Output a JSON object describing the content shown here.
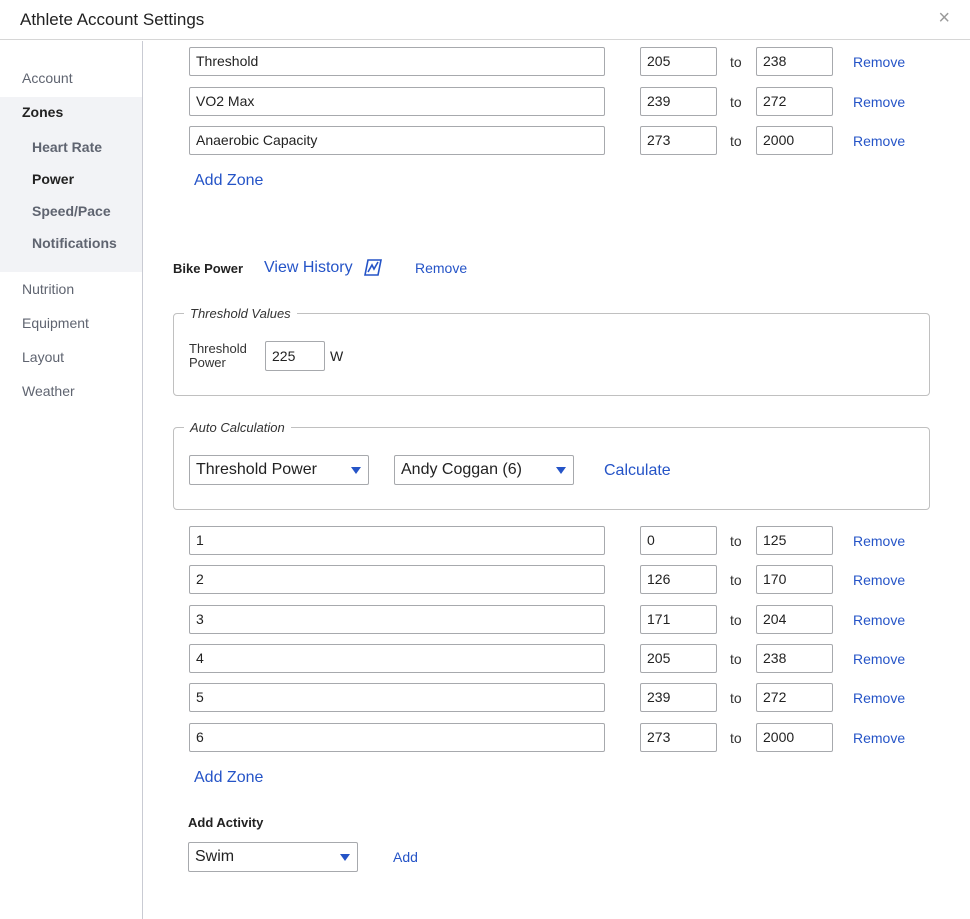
{
  "window": {
    "title": "Athlete Account Settings",
    "close_glyph": "×"
  },
  "sidebar": {
    "items": [
      {
        "label": "Account"
      },
      {
        "label": "Zones"
      },
      {
        "label": "Heart Rate"
      },
      {
        "label": "Power"
      },
      {
        "label": "Speed/Pace"
      },
      {
        "label": "Notifications"
      },
      {
        "label": "Nutrition"
      },
      {
        "label": "Equipment"
      },
      {
        "label": "Layout"
      },
      {
        "label": "Weather"
      }
    ]
  },
  "upper_zones": [
    {
      "name": "Threshold",
      "from": "205",
      "to": "238"
    },
    {
      "name": "VO2 Max",
      "from": "239",
      "to": "272"
    },
    {
      "name": "Anaerobic Capacity",
      "from": "273",
      "to": "2000"
    }
  ],
  "labels": {
    "to": "to",
    "remove": "Remove",
    "add_zone": "Add Zone"
  },
  "bike_power": {
    "label": "Bike Power",
    "view_history": "View History",
    "remove": "Remove",
    "threshold_values": {
      "legend": "Threshold Values",
      "label_line1": "Threshold",
      "label_line2": "Power",
      "value": "225",
      "unit": "W"
    },
    "auto_calculation": {
      "legend": "Auto Calculation",
      "method": "Threshold Power",
      "model": "Andy Coggan (6)",
      "calculate": "Calculate"
    },
    "zones": [
      {
        "name": "1",
        "from": "0",
        "to": "125"
      },
      {
        "name": "2",
        "from": "126",
        "to": "170"
      },
      {
        "name": "3",
        "from": "171",
        "to": "204"
      },
      {
        "name": "4",
        "from": "205",
        "to": "238"
      },
      {
        "name": "5",
        "from": "239",
        "to": "272"
      },
      {
        "name": "6",
        "from": "273",
        "to": "2000"
      }
    ]
  },
  "add_activity": {
    "label": "Add Activity",
    "selected": "Swim",
    "add": "Add"
  },
  "colors": {
    "link": "#2554c7",
    "sidebar_highlight": "#f2f3f6",
    "border": "#a7a9ad"
  }
}
